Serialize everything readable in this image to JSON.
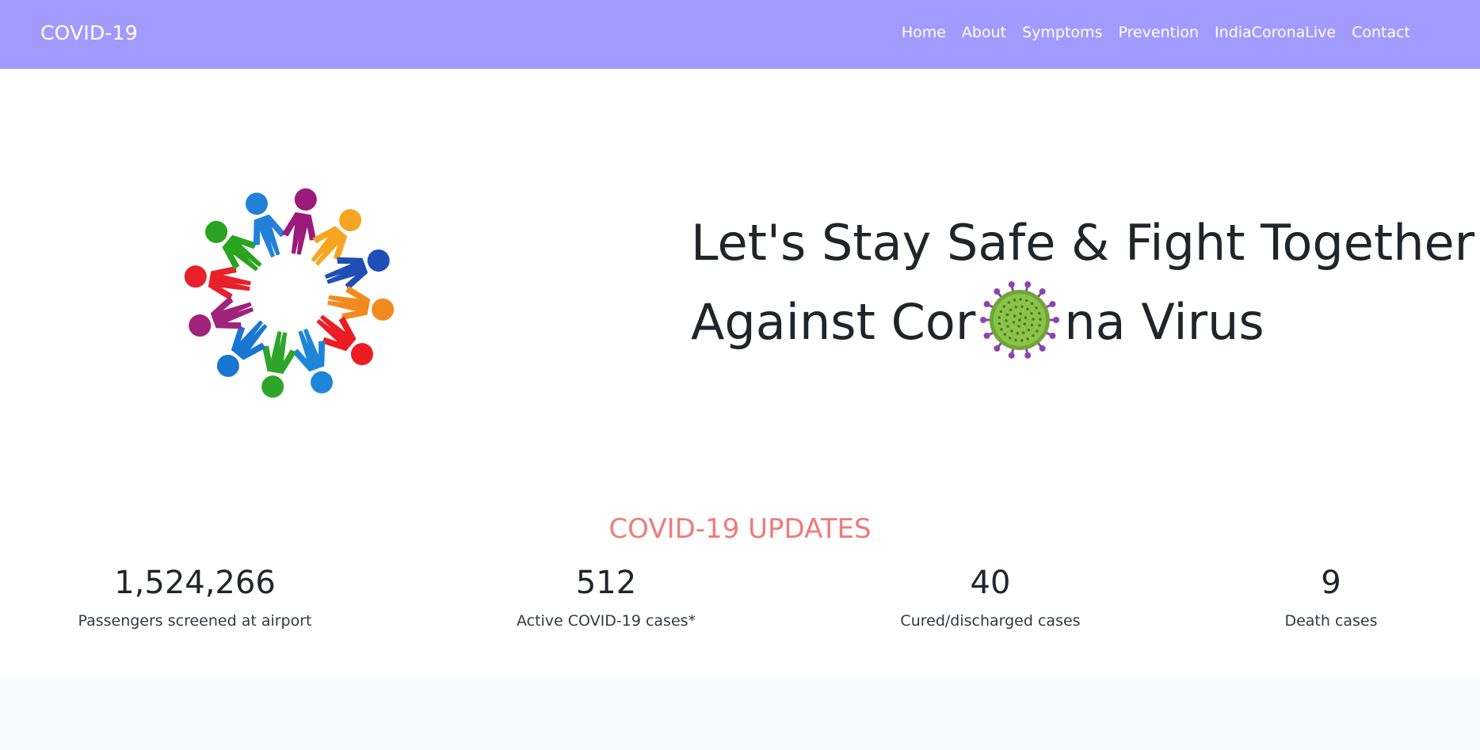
{
  "nav": {
    "brand": "COVID-19",
    "links": [
      "Home",
      "About",
      "Symptoms",
      "Prevention",
      "IndiaCoronaLive",
      "Contact"
    ]
  },
  "hero": {
    "title_line1": "Let's Stay Safe & Fight Together",
    "title_line2_before": "Against Cor",
    "title_line2_after": "na Virus",
    "graphic_icon": "people-circle-icon",
    "virus_icon": "coronavirus-icon"
  },
  "updates": {
    "title": "COVID-19 UPDATES",
    "stats": [
      {
        "value": "1,524,266",
        "label": "Passengers screened at airport"
      },
      {
        "value": "512",
        "label": "Active COVID-19 cases*"
      },
      {
        "value": "40",
        "label": "Cured/discharged cases"
      },
      {
        "value": "9",
        "label": "Death cases"
      }
    ]
  },
  "colors": {
    "navbar": "#a29bfe",
    "accent": "#ef7b7b",
    "virus_green": "#8bc34a",
    "virus_spikes": "#8e44ad"
  }
}
